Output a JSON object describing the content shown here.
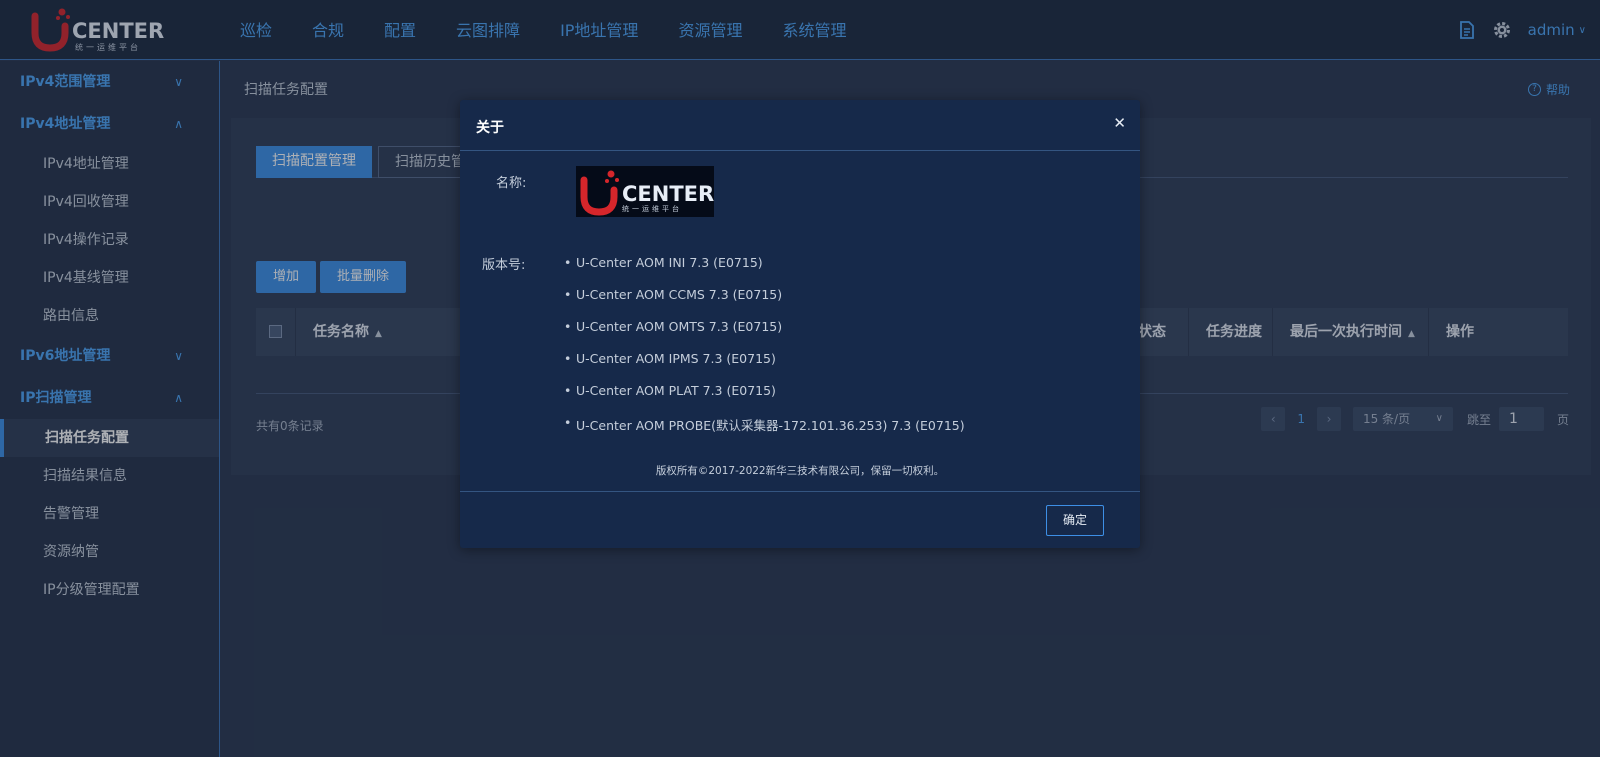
{
  "header": {
    "logo_text": "CENTER",
    "logo_sub": "统一运维平台",
    "nav": [
      "巡检",
      "合规",
      "配置",
      "云图排障",
      "IP地址管理",
      "资源管理",
      "系统管理"
    ],
    "user": "admin",
    "icons": [
      "document-icon",
      "gear-icon"
    ]
  },
  "sidebar": {
    "groups": [
      {
        "label": "IPv4范围管理",
        "expanded": false,
        "items": []
      },
      {
        "label": "IPv4地址管理",
        "expanded": true,
        "items": [
          "IPv4地址管理",
          "IPv4回收管理",
          "IPv4操作记录",
          "IPv4基线管理",
          "路由信息"
        ]
      },
      {
        "label": "IPv6地址管理",
        "expanded": false,
        "items": []
      },
      {
        "label": "IP扫描管理",
        "expanded": true,
        "items": [
          "扫描任务配置",
          "扫描结果信息",
          "告警管理",
          "资源纳管",
          "IP分级管理配置"
        ]
      }
    ],
    "active_item": "扫描任务配置"
  },
  "main": {
    "breadcrumb": "扫描任务配置",
    "help": "帮助",
    "tabs": [
      "扫描配置管理",
      "扫描历史管理"
    ],
    "buttons": {
      "add": "增加",
      "batch_delete": "批量删除"
    },
    "columns": [
      "任务名称",
      "务状态",
      "任务进度",
      "最后一次执行时间",
      "操作"
    ],
    "total": "共有0条记录",
    "pager": {
      "page": "1",
      "page_size": "15 条/页",
      "jump_label": "跳至",
      "jump_value": "1",
      "page_label": "页"
    }
  },
  "dialog": {
    "title": "关于",
    "name_label": "名称:",
    "version_label": "版本号:",
    "logo_text": "CENTER",
    "logo_sub": "统一运维平台",
    "versions": [
      "U-Center AOM INI 7.3 (E0715)",
      "U-Center AOM CCMS 7.3 (E0715)",
      "U-Center AOM OMTS 7.3 (E0715)",
      "U-Center AOM IPMS 7.3 (E0715)",
      "U-Center AOM PLAT 7.3 (E0715)",
      "U-Center AOM PROBE(默认采集器-172.101.36.253) 7.3 (E0715)"
    ],
    "copyright": "版权所有©2017-2022新华三技术有限公司，保留一切权利。",
    "ok": "确定"
  },
  "colors": {
    "accent": "#3d8fe6",
    "link": "#4da4f5",
    "logo_red": "#d6262b"
  }
}
